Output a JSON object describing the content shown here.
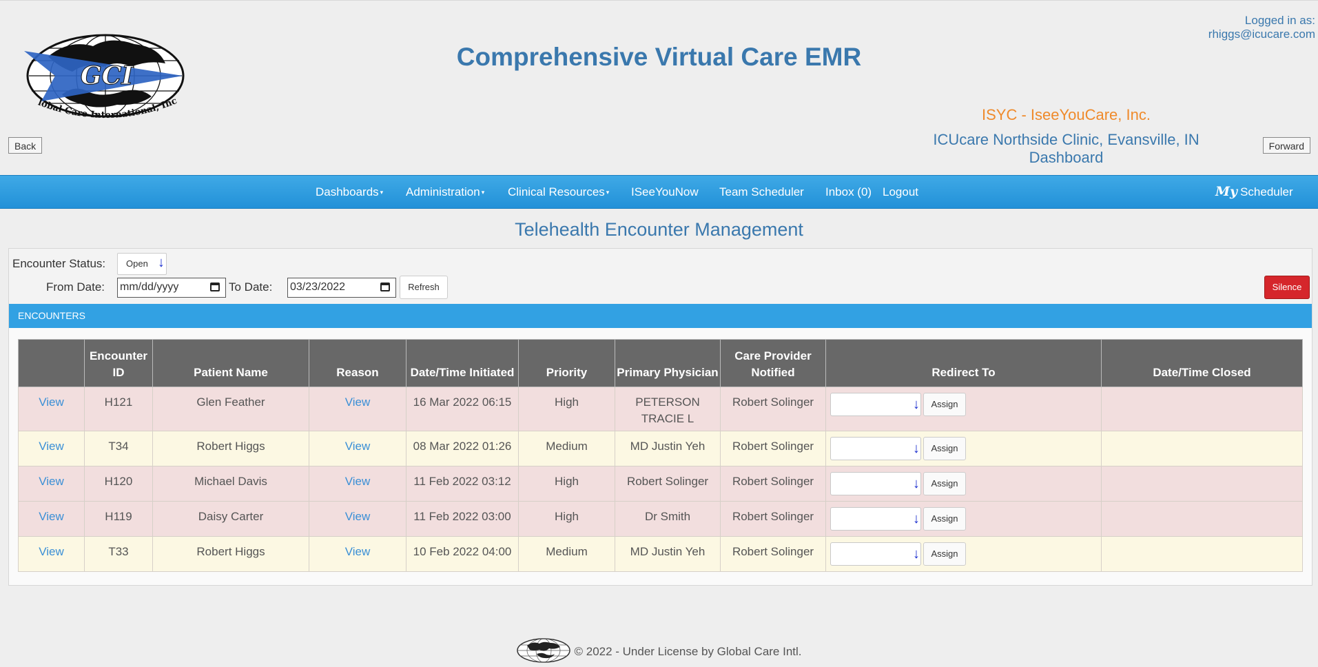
{
  "header": {
    "app_title": "Comprehensive Virtual Care EMR",
    "logged_in_label": "Logged in as:",
    "logged_in_user": "rhiggs@icucare.com",
    "org_name": "ISYC - IseeYouCare, Inc.",
    "clinic_line1": "ICUcare Northside Clinic, Evansville, IN",
    "clinic_line2": "Dashboard",
    "back_label": "Back",
    "forward_label": "Forward",
    "logo": {
      "initials": "GCI",
      "company": "Global Care International, Inc."
    }
  },
  "nav": {
    "items": [
      {
        "label": "Dashboards"
      },
      {
        "label": "Administration"
      },
      {
        "label": "Clinical Resources"
      },
      {
        "label": "ISeeYouNow"
      },
      {
        "label": "Team Scheduler"
      },
      {
        "label": "Inbox (0)"
      },
      {
        "label": "Logout"
      }
    ],
    "my_scheduler": {
      "prefix": "My",
      "label": "Scheduler"
    }
  },
  "page_title": "Telehealth Encounter Management",
  "filters": {
    "status_label": "Encounter Status:",
    "status_value": "Open",
    "from_label": "From Date:",
    "from_value": "mm/dd/yyyy",
    "to_label": "To Date:",
    "to_value": "03/23/2022",
    "refresh_label": "Refresh",
    "silence_label": "Silence"
  },
  "encounters": {
    "section_title": "ENCOUNTERS",
    "columns": [
      "",
      "Encounter ID",
      "Patient Name",
      "Reason",
      "Date/Time Initiated",
      "Priority",
      "Primary Physician",
      "Care Provider Notified",
      "Redirect To",
      "Date/Time Closed"
    ],
    "rows": [
      {
        "view": "View",
        "id": "H121",
        "patient": "Glen Feather",
        "reason": "View",
        "initiated": "16 Mar 2022 06:15",
        "priority": "High",
        "physician": "PETERSON TRACIE L",
        "provider": "Robert Solinger",
        "redirect": "",
        "assign": "Assign",
        "closed": "",
        "tone": "pink"
      },
      {
        "view": "View",
        "id": "T34",
        "patient": "Robert Higgs",
        "reason": "View",
        "initiated": "08 Mar 2022 01:26",
        "priority": "Medium",
        "physician": "MD Justin Yeh",
        "provider": "Robert Solinger",
        "redirect": "",
        "assign": "Assign",
        "closed": "",
        "tone": "cream"
      },
      {
        "view": "View",
        "id": "H120",
        "patient": "Michael Davis",
        "reason": "View",
        "initiated": "11 Feb 2022 03:12",
        "priority": "High",
        "physician": "Robert Solinger",
        "provider": "Robert Solinger",
        "redirect": "",
        "assign": "Assign",
        "closed": "",
        "tone": "pink"
      },
      {
        "view": "View",
        "id": "H119",
        "patient": "Daisy Carter",
        "reason": "View",
        "initiated": "11 Feb 2022 03:00",
        "priority": "High",
        "physician": "Dr Smith",
        "provider": "Robert Solinger",
        "redirect": "",
        "assign": "Assign",
        "closed": "",
        "tone": "pink"
      },
      {
        "view": "View",
        "id": "T33",
        "patient": "Robert Higgs",
        "reason": "View",
        "initiated": "10 Feb 2022 04:00",
        "priority": "Medium",
        "physician": "MD Justin Yeh",
        "provider": "Robert Solinger",
        "redirect": "",
        "assign": "Assign",
        "closed": "",
        "tone": "cream"
      }
    ]
  },
  "footer": {
    "text": "© 2022 - Under License by Global Care Intl."
  },
  "colors": {
    "brand_blue": "#3a78ad",
    "nav_blue": "#2291d8",
    "org_orange": "#ef8a2b",
    "silence_red": "#d5262b",
    "row_pink": "#f2dede",
    "row_cream": "#fcf8e3"
  }
}
